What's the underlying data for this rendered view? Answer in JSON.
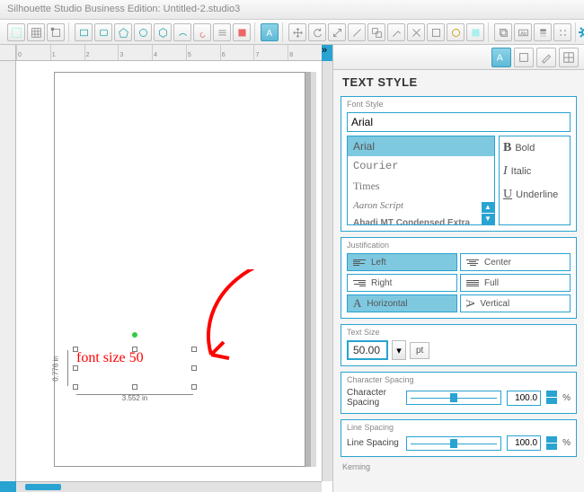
{
  "window": {
    "title": "Silhouette Studio Business Edition: Untitled-2.studio3"
  },
  "canvas": {
    "selection_text": "font size 50",
    "dim_width": "3.552 in",
    "dim_height": "0.776 in"
  },
  "panel": {
    "title": "TEXT STYLE",
    "font_style": {
      "label": "Font Style",
      "current": "Arial",
      "list": [
        "Arial",
        "Courier",
        "Times",
        "Aaron Script",
        "Abadi MT Condensed Extra"
      ],
      "styles": {
        "bold": "Bold",
        "italic": "Italic",
        "underline": "Underline"
      }
    },
    "justification": {
      "label": "Justification",
      "left": "Left",
      "center": "Center",
      "right": "Right",
      "full": "Full",
      "horizontal": "Horizontal",
      "vertical": "Vertical"
    },
    "text_size": {
      "label": "Text Size",
      "value": "50.00",
      "unit": "pt"
    },
    "char_spacing": {
      "label": "Character Spacing",
      "short": "Character Spacing",
      "value": "100.0",
      "pct": "%"
    },
    "line_spacing": {
      "label": "Line Spacing",
      "short": "Line Spacing",
      "value": "100.0",
      "pct": "%"
    },
    "kerning": {
      "label": "Kerning"
    }
  }
}
